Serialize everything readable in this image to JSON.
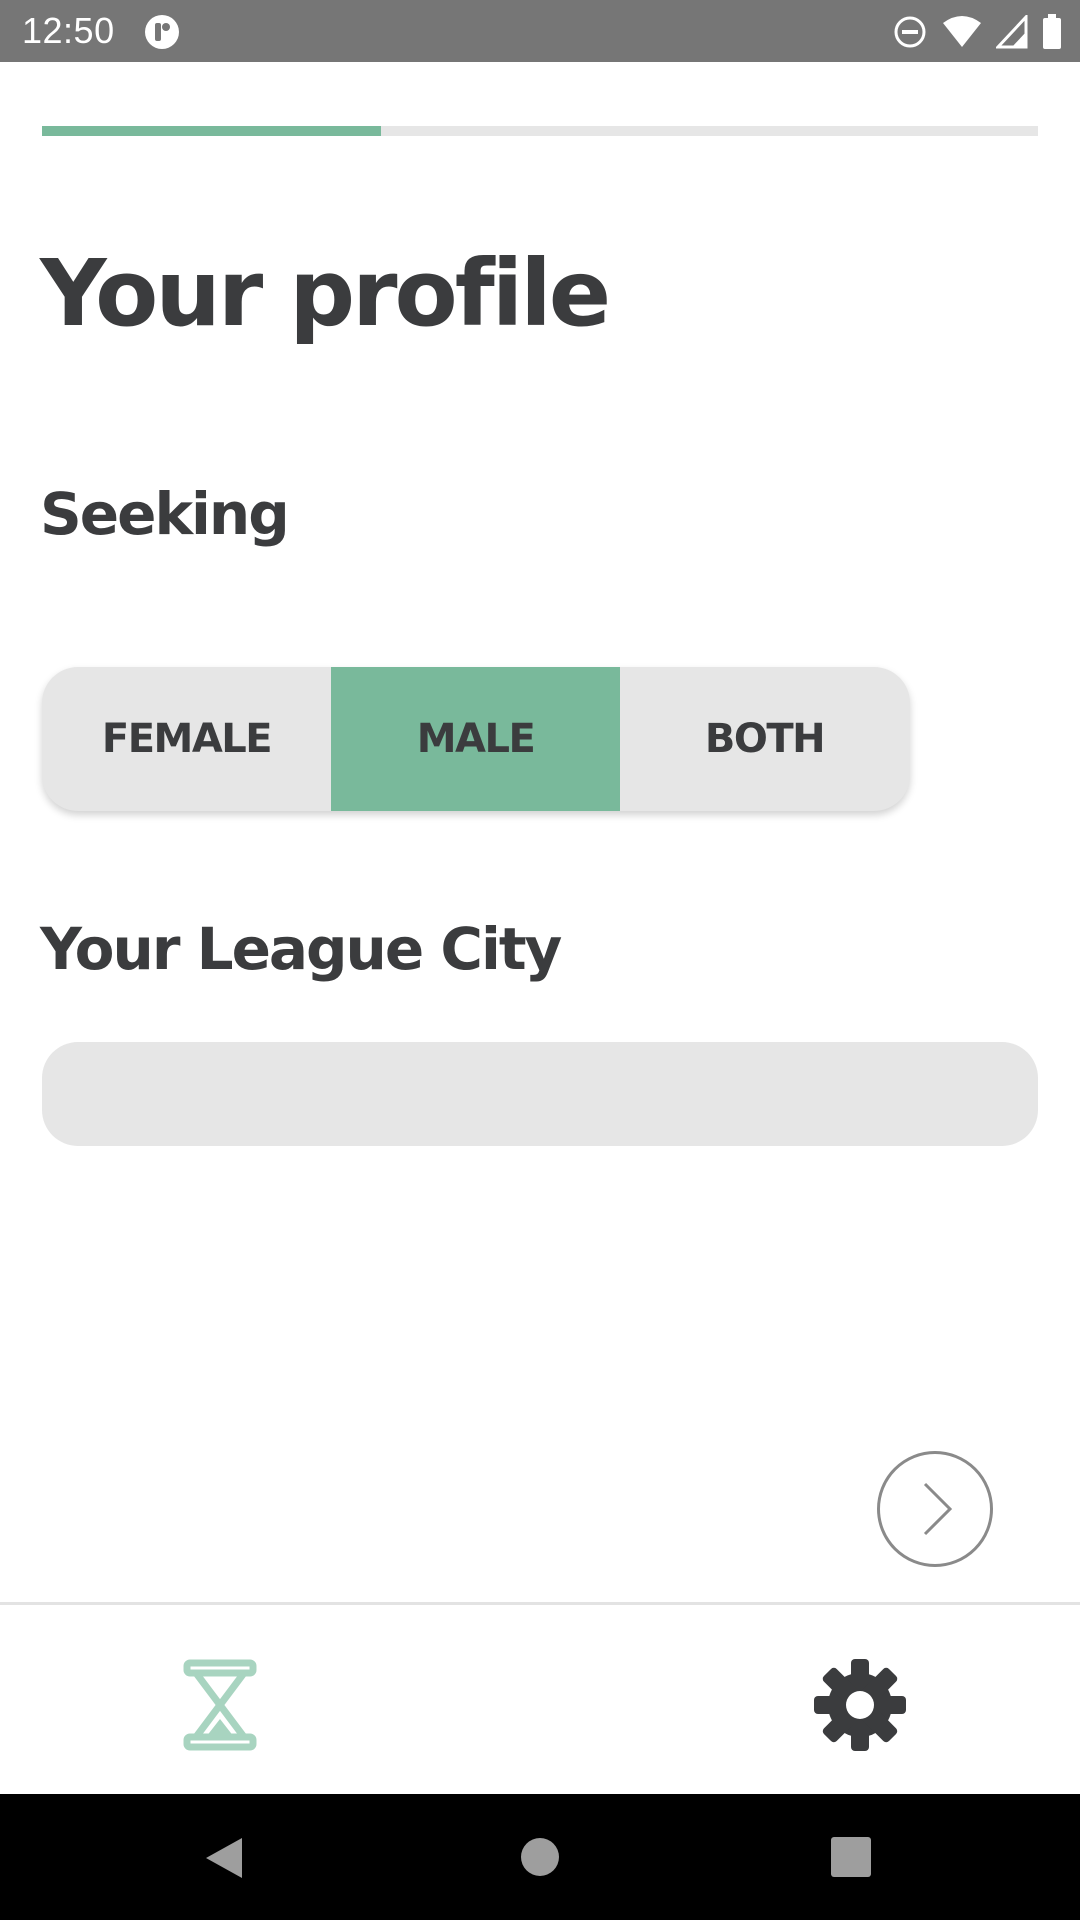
{
  "status_bar": {
    "time": "12:50",
    "icons": [
      "app-notification-icon",
      "do-not-disturb-icon",
      "wifi-icon",
      "cell-signal-icon",
      "battery-icon"
    ]
  },
  "progress": {
    "fraction": 0.34,
    "color": "#79b99b"
  },
  "page": {
    "title": "Your profile"
  },
  "seeking": {
    "label": "Seeking",
    "options": [
      "FEMALE",
      "MALE",
      "BOTH"
    ],
    "selected": "MALE"
  },
  "league_city": {
    "label": "Your League City",
    "value": "",
    "placeholder": ""
  },
  "next_button": {
    "icon": "chevron-right-icon"
  },
  "bottom_nav": {
    "items": [
      {
        "icon": "hourglass-icon",
        "active": true
      },
      {
        "icon": "gear-icon",
        "active": false
      }
    ]
  },
  "system_nav": {
    "icons": [
      "back-icon",
      "home-icon",
      "recents-icon"
    ]
  },
  "colors": {
    "accent": "#79b99b",
    "text": "#3b3c3e",
    "field_bg": "#e6e6e6",
    "status_bar": "#767676"
  }
}
